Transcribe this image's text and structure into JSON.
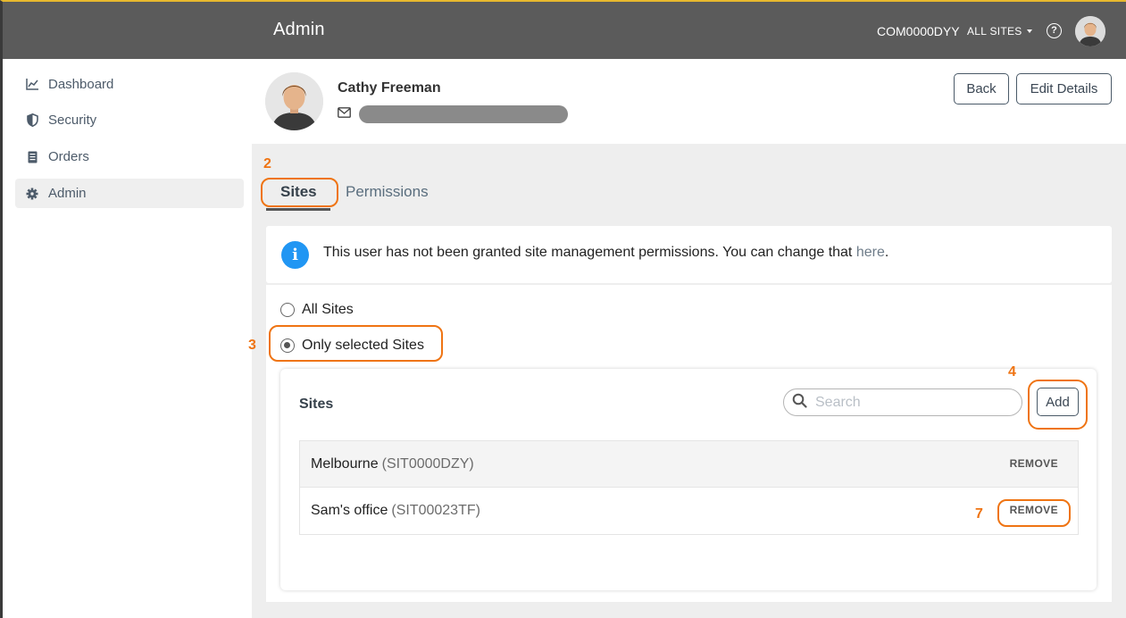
{
  "header": {
    "app_title": "Admin",
    "company_code": "COM0000DYY",
    "site_selector": "ALL SITES",
    "help_label": "?"
  },
  "sidebar": {
    "items": [
      {
        "label": "Dashboard",
        "icon": "chart-line-icon"
      },
      {
        "label": "Security",
        "icon": "shield-icon"
      },
      {
        "label": "Orders",
        "icon": "clipboard-icon"
      },
      {
        "label": "Admin",
        "icon": "gear-icon",
        "active": true
      }
    ]
  },
  "profile": {
    "name": "Cathy Freeman",
    "back_label": "Back",
    "edit_label": "Edit Details"
  },
  "tabs": {
    "sites": "Sites",
    "permissions": "Permissions"
  },
  "info": {
    "icon_glyph": "i",
    "message": "This user has not been granted site management permissions. You can change that ",
    "link": "here",
    "suffix": "."
  },
  "access": {
    "all_sites": "All Sites",
    "only_selected": "Only selected Sites",
    "selected": "only_selected"
  },
  "sites_card": {
    "title": "Sites",
    "search_placeholder": "Search",
    "add_label": "Add",
    "rows": [
      {
        "name": "Melbourne",
        "code": "(SIT0000DZY)",
        "action": "REMOVE"
      },
      {
        "name": "Sam's office",
        "code": "(SIT00023TF)",
        "action": "REMOVE"
      }
    ]
  },
  "annotations": {
    "n2": "2",
    "n3": "3",
    "n4": "4",
    "n7": "7"
  },
  "colors": {
    "header_bg": "#5b5b5b",
    "header_accent": "#e7b82e",
    "info_blue": "#2196f3",
    "annotation_orange": "#ef7413"
  }
}
